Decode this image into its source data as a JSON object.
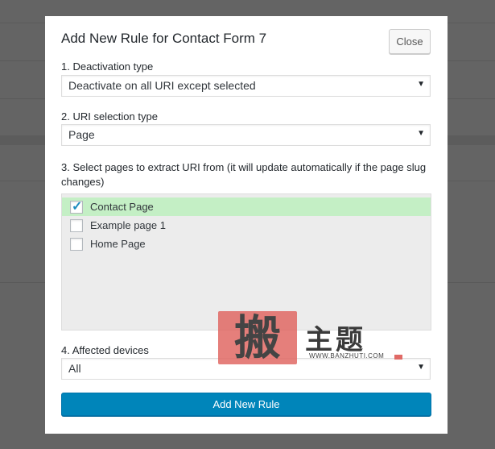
{
  "dialog": {
    "title": "Add New Rule for Contact Form 7",
    "close_label": "Close",
    "deactivation": {
      "label": "1. Deactivation type",
      "value": "Deactivate on all URI except selected"
    },
    "uri_selection": {
      "label": "2. URI selection type",
      "value": "Page"
    },
    "pages": {
      "label": "3. Select pages to extract URI from (it will update automatically if the page slug changes)",
      "items": [
        {
          "label": "Contact Page",
          "checked": true
        },
        {
          "label": "Example page 1",
          "checked": false
        },
        {
          "label": "Home Page",
          "checked": false
        }
      ]
    },
    "devices": {
      "label": "4. Affected devices",
      "value": "All"
    },
    "submit_label": "Add New Rule"
  },
  "watermark": {
    "stamp": "搬",
    "chars": "主题",
    "url": "WWW.BANZHUTI.COM"
  },
  "colors": {
    "overlay": "#646464",
    "primary": "#0085ba",
    "selected_row": "#c4efc5",
    "list_bg": "#ececec"
  }
}
